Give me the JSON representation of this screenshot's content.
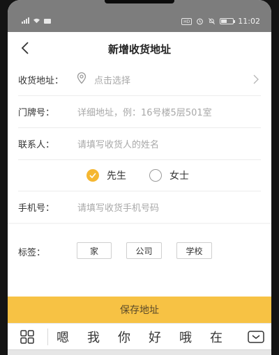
{
  "status_bar": {
    "time": "11:02",
    "hd_badge": "HD",
    "battery_label": "50",
    "battery_level": 0.5
  },
  "header": {
    "title": "新增收货地址",
    "back_icon": "back-arrow-icon"
  },
  "form": {
    "address": {
      "label": "收货地址：",
      "placeholder": "点击选择",
      "icon": "location-icon"
    },
    "door": {
      "label": "门牌号：",
      "placeholder": "详细地址，例：16号楼5层501室"
    },
    "contact": {
      "label": "联系人：",
      "placeholder": "请填写收货人的姓名"
    },
    "gender": {
      "options": [
        "先生",
        "女士"
      ],
      "selected": "先生"
    },
    "phone": {
      "label": "手机号：",
      "placeholder": "请填写收货手机号码"
    },
    "tags": {
      "label": "标签：",
      "options": [
        "家",
        "公司",
        "学校"
      ]
    }
  },
  "save_button": "保存地址",
  "keyboard": {
    "candidates": [
      "嗯",
      "我",
      "你",
      "好",
      "哦",
      "在"
    ]
  },
  "colors": {
    "accent": "#f7c244",
    "status_bar": "#7d7d7d",
    "placeholder": "#a8a8a8"
  }
}
